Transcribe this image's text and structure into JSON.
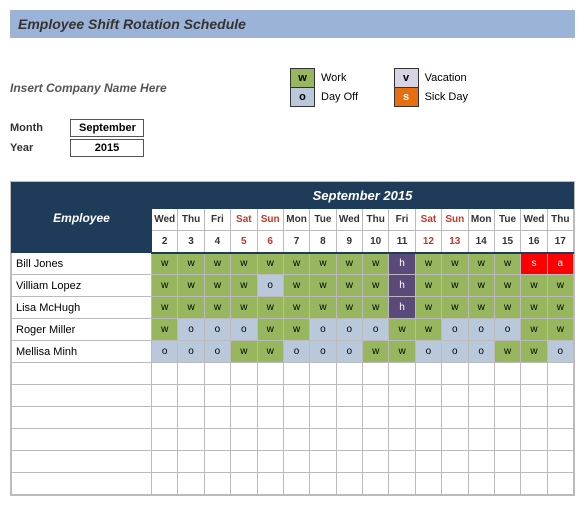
{
  "title": "Employee Shift Rotation Schedule",
  "company_placeholder": "Insert Company Name Here",
  "legend": {
    "work": {
      "code": "w",
      "label": "Work"
    },
    "vacation": {
      "code": "v",
      "label": "Vacation"
    },
    "dayoff": {
      "code": "o",
      "label": "Day Off"
    },
    "sick": {
      "code": "s",
      "label": "Sick Day"
    }
  },
  "month_label": "Month",
  "year_label": "Year",
  "month_value": "September",
  "year_value": "2015",
  "table_month_header": "September 2015",
  "employee_header": "Employee",
  "days": [
    {
      "dow": "Wed",
      "num": "2",
      "wknd": false
    },
    {
      "dow": "Thu",
      "num": "3",
      "wknd": false
    },
    {
      "dow": "Fri",
      "num": "4",
      "wknd": false
    },
    {
      "dow": "Sat",
      "num": "5",
      "wknd": true
    },
    {
      "dow": "Sun",
      "num": "6",
      "wknd": true
    },
    {
      "dow": "Mon",
      "num": "7",
      "wknd": false
    },
    {
      "dow": "Tue",
      "num": "8",
      "wknd": false
    },
    {
      "dow": "Wed",
      "num": "9",
      "wknd": false
    },
    {
      "dow": "Thu",
      "num": "10",
      "wknd": false
    },
    {
      "dow": "Fri",
      "num": "11",
      "wknd": false
    },
    {
      "dow": "Sat",
      "num": "12",
      "wknd": true
    },
    {
      "dow": "Sun",
      "num": "13",
      "wknd": true
    },
    {
      "dow": "Mon",
      "num": "14",
      "wknd": false
    },
    {
      "dow": "Tue",
      "num": "15",
      "wknd": false
    },
    {
      "dow": "Wed",
      "num": "16",
      "wknd": false
    },
    {
      "dow": "Thu",
      "num": "17",
      "wknd": false
    }
  ],
  "employees": [
    {
      "name": "Bill Jones",
      "shifts": [
        "w",
        "w",
        "w",
        "w",
        "w",
        "w",
        "w",
        "w",
        "w",
        "h",
        "w",
        "w",
        "w",
        "w",
        "s",
        "a"
      ]
    },
    {
      "name": "Villiam Lopez",
      "shifts": [
        "w",
        "w",
        "w",
        "w",
        "o",
        "w",
        "w",
        "w",
        "w",
        "h",
        "w",
        "w",
        "w",
        "w",
        "w",
        "w"
      ]
    },
    {
      "name": "Lisa McHugh",
      "shifts": [
        "w",
        "w",
        "w",
        "w",
        "w",
        "w",
        "w",
        "w",
        "w",
        "h",
        "w",
        "w",
        "w",
        "w",
        "w",
        "w"
      ]
    },
    {
      "name": "Roger Miller",
      "shifts": [
        "w",
        "o",
        "o",
        "o",
        "w",
        "w",
        "o",
        "o",
        "o",
        "w",
        "w",
        "o",
        "o",
        "o",
        "w",
        "w"
      ]
    },
    {
      "name": "Mellisa Minh",
      "shifts": [
        "o",
        "o",
        "o",
        "w",
        "w",
        "o",
        "o",
        "o",
        "w",
        "w",
        "o",
        "o",
        "o",
        "w",
        "w",
        "o"
      ]
    }
  ],
  "empty_rows": 6
}
